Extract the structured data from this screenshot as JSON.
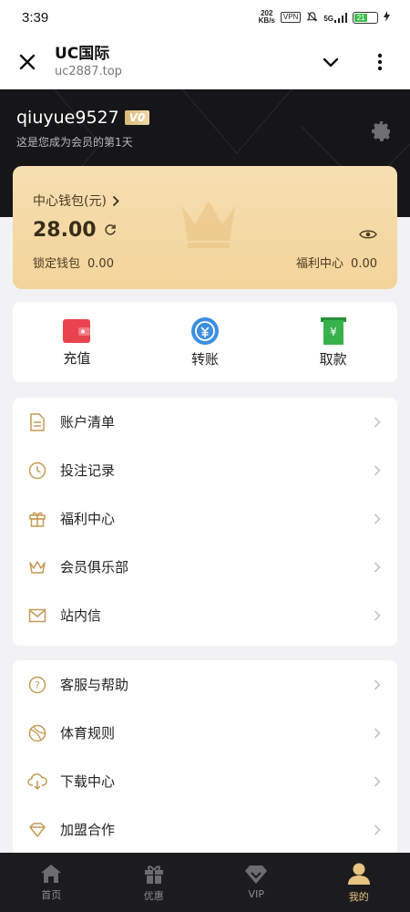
{
  "status_bar": {
    "time": "3:39",
    "net_speed": "202\nKB/s",
    "vpn": "VPN",
    "signal": "5G",
    "battery": "21"
  },
  "browser": {
    "title": "UC国际",
    "url": "uc2887.top"
  },
  "profile": {
    "username": "qiuyue9527",
    "vip_level": "V0",
    "member_days": "这是您成为会员的第1天"
  },
  "wallet": {
    "title": "中心钱包(元)",
    "amount": "28.00",
    "locked_label": "锁定钱包",
    "locked_value": "0.00",
    "welfare_label": "福利中心",
    "welfare_value": "0.00"
  },
  "actions": [
    {
      "label": "充值",
      "icon": "wallet-icon",
      "color": "#e8434f"
    },
    {
      "label": "转账",
      "icon": "transfer-icon",
      "color": "#3d8fe0"
    },
    {
      "label": "取款",
      "icon": "cash-icon",
      "color": "#37b24a"
    }
  ],
  "menu_group_1": [
    {
      "label": "账户清单",
      "icon": "document-icon"
    },
    {
      "label": "投注记录",
      "icon": "clock-icon"
    },
    {
      "label": "福利中心",
      "icon": "gift-icon"
    },
    {
      "label": "会员俱乐部",
      "icon": "crown-icon"
    },
    {
      "label": "站内信",
      "icon": "mail-icon"
    }
  ],
  "menu_group_2": [
    {
      "label": "客服与帮助",
      "icon": "help-icon"
    },
    {
      "label": "体育规则",
      "icon": "ball-icon"
    },
    {
      "label": "下载中心",
      "icon": "download-icon"
    },
    {
      "label": "加盟合作",
      "icon": "diamond-icon"
    }
  ],
  "bottom_nav": [
    {
      "label": "首页",
      "icon": "home-icon",
      "active": false
    },
    {
      "label": "优惠",
      "icon": "gift-icon",
      "active": false
    },
    {
      "label": "VIP",
      "icon": "diamond-icon",
      "active": false
    },
    {
      "label": "我的",
      "icon": "user-icon",
      "active": true
    }
  ],
  "colors": {
    "gold_accent": "#e7c482",
    "header_bg": "#161618",
    "icon_gold": "#c49a55"
  }
}
